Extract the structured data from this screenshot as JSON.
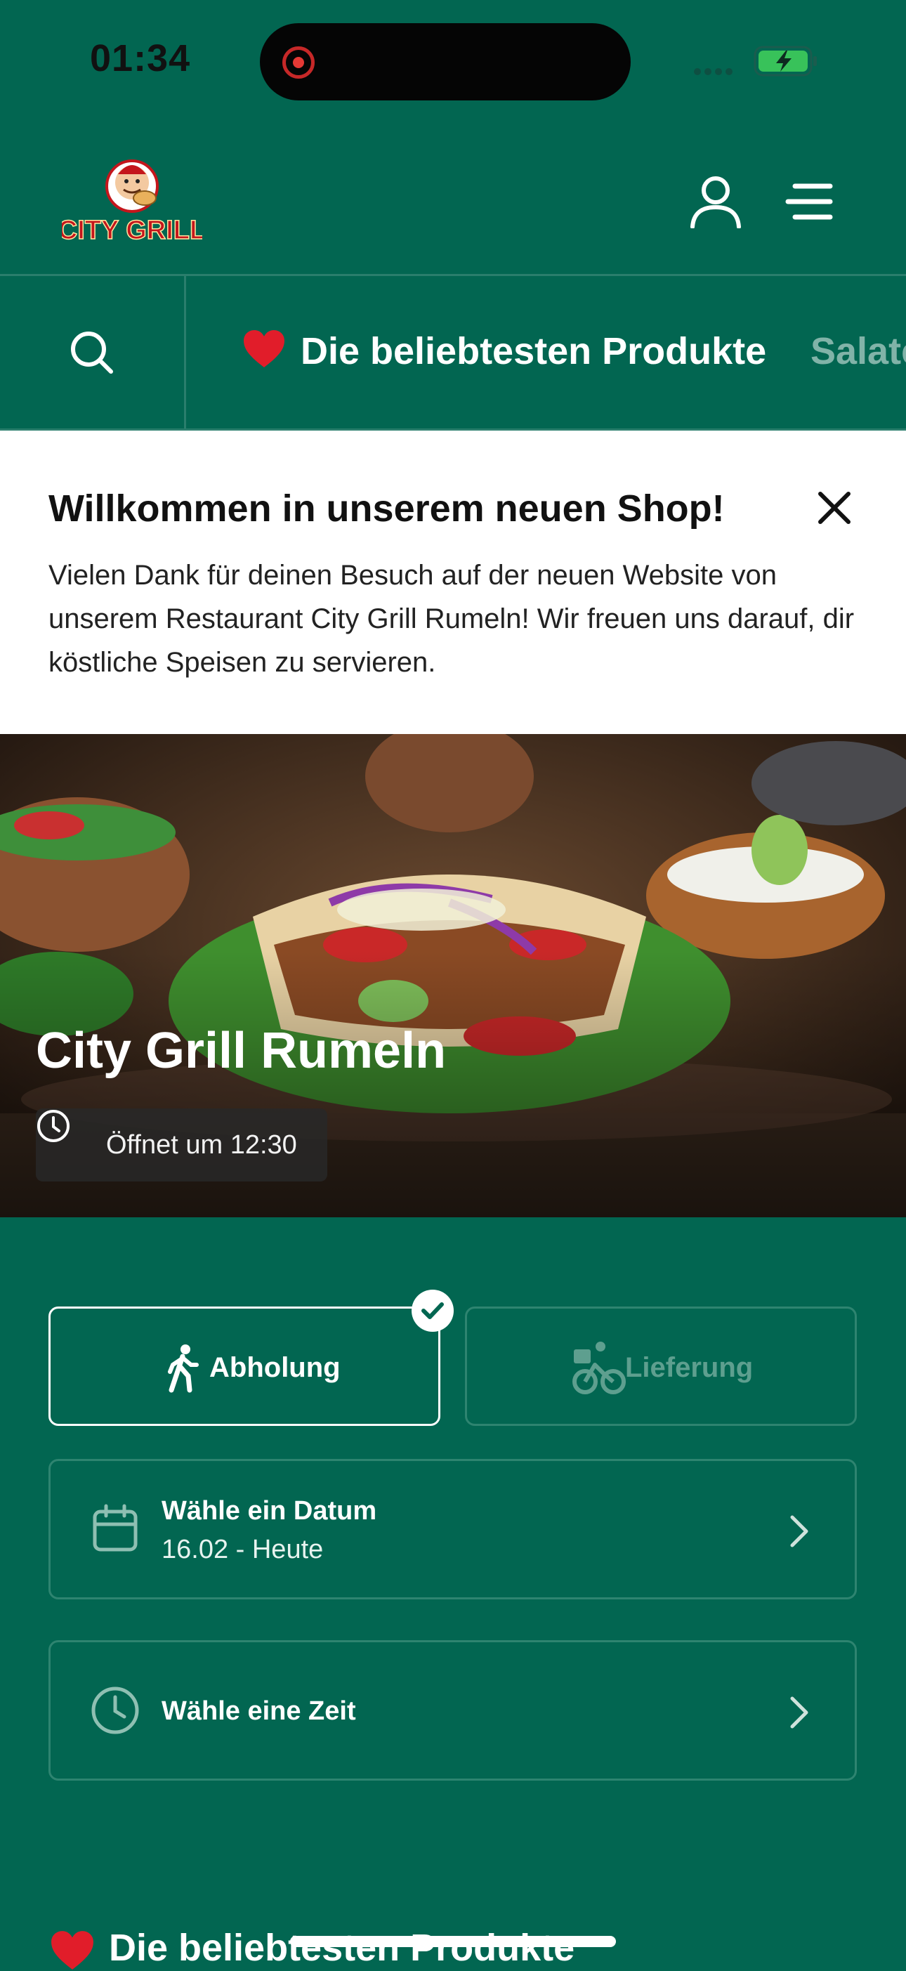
{
  "status_bar": {
    "time": "01:34"
  },
  "header": {
    "logo_text": "CITY GRILL",
    "brand_colors": {
      "background": "#026651",
      "logo_red": "#c4161c"
    },
    "icons": [
      "user-icon",
      "menu-icon"
    ]
  },
  "category_bar": {
    "items": [
      "Die beliebtesten Produkte",
      "Salate"
    ],
    "heart_icon": "heart-icon"
  },
  "notice": {
    "title": "Willkommen in unserem neuen Shop!",
    "text": "Vielen Dank für deinen Besuch auf der neuen Website von unserem Restaurant City Grill Rumeln! Wir freuen uns darauf, dir köstliche Speisen zu servieren."
  },
  "hero": {
    "restaurant_name": "City Grill Rumeln",
    "opening_hours": "Öffnet um 12:30"
  },
  "order_method": {
    "pickup": "Abholung",
    "delivery": "Lieferung",
    "selected": "pickup"
  },
  "date_selector": {
    "title": "Wähle ein Datum",
    "value": "16.02 - Heute"
  },
  "time_selector": {
    "title": "Wähle eine Zeit"
  },
  "products_section": {
    "heading": "Die beliebtesten Produkte"
  }
}
